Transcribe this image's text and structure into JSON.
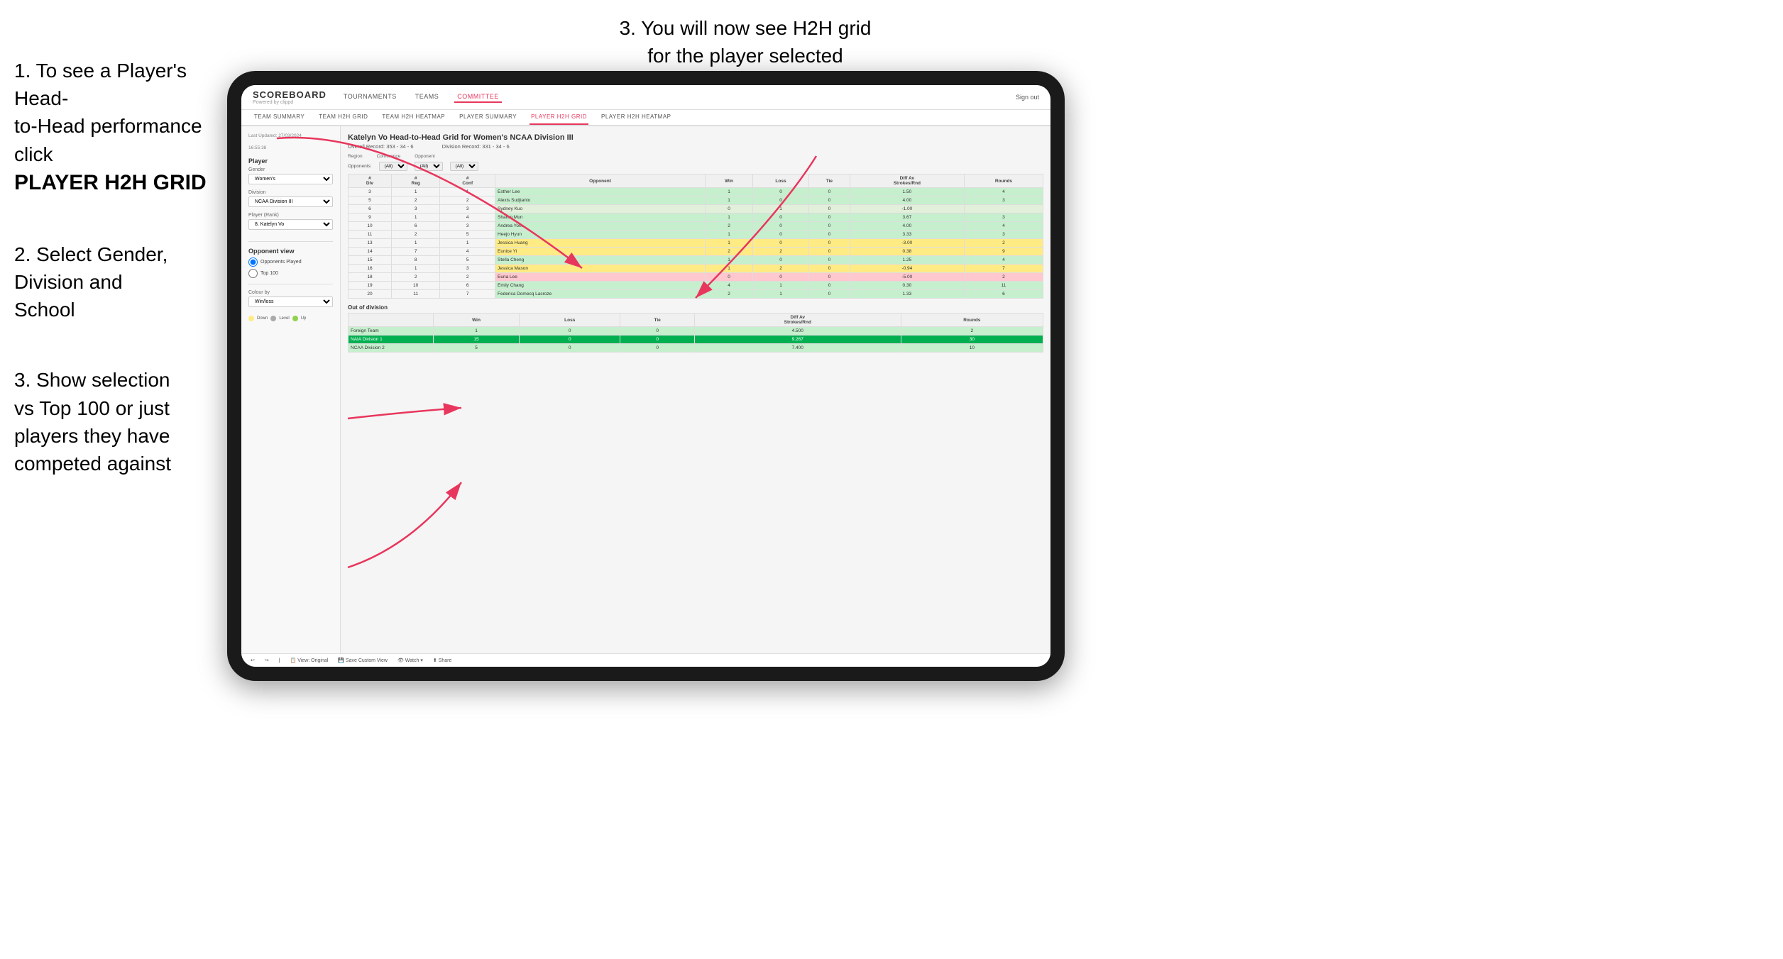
{
  "instructions": {
    "step1_line1": "1. To see a Player's Head-",
    "step1_line2": "to-Head performance click",
    "step1_bold": "PLAYER H2H GRID",
    "step2_line1": "2. Select Gender,",
    "step2_line2": "Division and",
    "step2_line3": "School",
    "step3_right_line1": "3. You will now see H2H grid",
    "step3_right_line2": "for the player selected",
    "step3_left_line1": "3. Show selection",
    "step3_left_line2": "vs Top 100 or just",
    "step3_left_line3": "players they have",
    "step3_left_line4": "competed against"
  },
  "app": {
    "logo_title": "SCOREBOARD",
    "logo_subtitle": "Powered by clippd",
    "nav": [
      "TOURNAMENTS",
      "TEAMS",
      "COMMITTEE"
    ],
    "sign_out": "Sign out",
    "sub_nav": [
      "TEAM SUMMARY",
      "TEAM H2H GRID",
      "TEAM H2H HEATMAP",
      "PLAYER SUMMARY",
      "PLAYER H2H GRID",
      "PLAYER H2H HEATMAP"
    ]
  },
  "left_panel": {
    "timestamp": "Last Updated: 27/03/2024",
    "timestamp2": "16:55:38",
    "player_section": "Player",
    "gender_label": "Gender",
    "gender_value": "Women's",
    "division_label": "Division",
    "division_value": "NCAA Division III",
    "player_rank_label": "Player (Rank)",
    "player_rank_value": "8. Katelyn Vo",
    "opponent_view_title": "Opponent view",
    "radio1": "Opponents Played",
    "radio2": "Top 100",
    "colour_by_label": "Colour by",
    "colour_by_value": "Win/loss",
    "legend_down": "Down",
    "legend_level": "Level",
    "legend_up": "Up"
  },
  "grid": {
    "title": "Katelyn Vo Head-to-Head Grid for Women's NCAA Division III",
    "overall_record_label": "Overall Record:",
    "overall_record": "353 - 34 - 6",
    "division_record_label": "Division Record:",
    "division_record": "331 - 34 - 6",
    "region_label": "Region",
    "conference_label": "Conference",
    "opponent_label": "Opponent",
    "opponents_filter_label": "Opponents:",
    "opponents_value": "(All)",
    "conference_value": "(All)",
    "opponent_value": "(All)",
    "col_headers": [
      "#\nDiv",
      "#\nReg",
      "#\nConf",
      "Opponent",
      "Win",
      "Loss",
      "Tie",
      "Diff Av\nStrokes/Rnd",
      "Rounds"
    ],
    "rows": [
      {
        "div": 3,
        "reg": 1,
        "conf": 1,
        "opponent": "Esther Lee",
        "win": 1,
        "loss": 0,
        "tie": 0,
        "diff": "1.50",
        "rounds": 4,
        "color": "green"
      },
      {
        "div": 5,
        "reg": 2,
        "conf": 2,
        "opponent": "Alexis Sudjianto",
        "win": 1,
        "loss": 0,
        "tie": 0,
        "diff": "4.00",
        "rounds": 3,
        "color": "green"
      },
      {
        "div": 6,
        "reg": 3,
        "conf": 3,
        "opponent": "Sydney Kuo",
        "win": 0,
        "loss": 1,
        "tie": 0,
        "diff": "-1.00",
        "rounds": "",
        "color": "light-green"
      },
      {
        "div": 9,
        "reg": 1,
        "conf": 4,
        "opponent": "Sharon Mun",
        "win": 1,
        "loss": 0,
        "tie": 0,
        "diff": "3.67",
        "rounds": 3,
        "color": "green"
      },
      {
        "div": 10,
        "reg": 6,
        "conf": 3,
        "opponent": "Andrea York",
        "win": 2,
        "loss": 0,
        "tie": 0,
        "diff": "4.00",
        "rounds": 4,
        "color": "green"
      },
      {
        "div": 11,
        "reg": 2,
        "conf": 5,
        "opponent": "Heejo Hyun",
        "win": 1,
        "loss": 0,
        "tie": 0,
        "diff": "3.33",
        "rounds": 3,
        "color": "green"
      },
      {
        "div": 13,
        "reg": 1,
        "conf": 1,
        "opponent": "Jessica Huang",
        "win": 1,
        "loss": 0,
        "tie": 0,
        "diff": "-3.00",
        "rounds": 2,
        "color": "yellow"
      },
      {
        "div": 14,
        "reg": 7,
        "conf": 4,
        "opponent": "Eunice Yi",
        "win": 2,
        "loss": 2,
        "tie": 0,
        "diff": "0.38",
        "rounds": 9,
        "color": "yellow"
      },
      {
        "div": 15,
        "reg": 8,
        "conf": 5,
        "opponent": "Stella Cheng",
        "win": 1,
        "loss": 0,
        "tie": 0,
        "diff": "1.25",
        "rounds": 4,
        "color": "green"
      },
      {
        "div": 16,
        "reg": 1,
        "conf": 3,
        "opponent": "Jessica Mason",
        "win": 1,
        "loss": 2,
        "tie": 0,
        "diff": "-0.94",
        "rounds": 7,
        "color": "yellow"
      },
      {
        "div": 18,
        "reg": 2,
        "conf": 2,
        "opponent": "Euna Lee",
        "win": 0,
        "loss": 0,
        "tie": 0,
        "diff": "-5.00",
        "rounds": 2,
        "color": "red"
      },
      {
        "div": 19,
        "reg": 10,
        "conf": 6,
        "opponent": "Emily Chang",
        "win": 4,
        "loss": 1,
        "tie": 0,
        "diff": "0.30",
        "rounds": 11,
        "color": "green"
      },
      {
        "div": 20,
        "reg": 11,
        "conf": 7,
        "opponent": "Federica Domecq Lacroze",
        "win": 2,
        "loss": 1,
        "tie": 0,
        "diff": "1.33",
        "rounds": 6,
        "color": "green"
      }
    ],
    "out_of_division_title": "Out of division",
    "out_of_division_rows": [
      {
        "opponent": "Foreign Team",
        "win": 1,
        "loss": 0,
        "tie": 0,
        "diff": "4.500",
        "rounds": 2,
        "color": "green"
      },
      {
        "opponent": "NAIA Division 1",
        "win": 15,
        "loss": 0,
        "tie": 0,
        "diff": "9.267",
        "rounds": 30,
        "color": "dark-green"
      },
      {
        "opponent": "NCAA Division 2",
        "win": 5,
        "loss": 0,
        "tie": 0,
        "diff": "7.400",
        "rounds": 10,
        "color": "green"
      }
    ]
  },
  "toolbar": {
    "undo": "↩",
    "view_original": "View: Original",
    "save_custom_view": "Save Custom View",
    "watch": "Watch",
    "share": "Share"
  }
}
